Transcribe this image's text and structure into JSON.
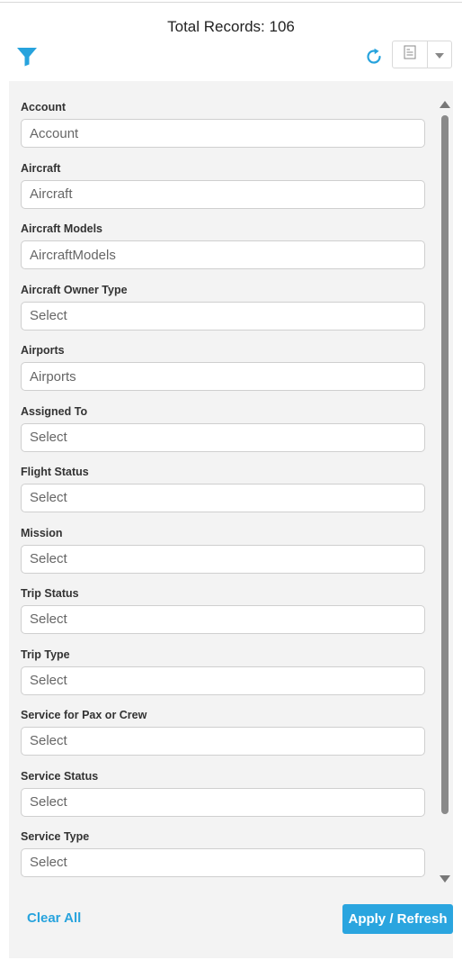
{
  "header": {
    "total_records": "Total Records: 106"
  },
  "toolbar": {
    "filter_icon": "filter-icon",
    "refresh_icon": "refresh-icon",
    "export_icon": "document-icon",
    "dropdown_icon": "caret-down-icon",
    "accent_color": "#27a3dd"
  },
  "filters": [
    {
      "label": "Account",
      "placeholder": "Account",
      "type": "input"
    },
    {
      "label": "Aircraft",
      "placeholder": "Aircraft",
      "type": "input"
    },
    {
      "label": "Aircraft Models",
      "placeholder": "AircraftModels",
      "type": "input"
    },
    {
      "label": "Aircraft Owner Type",
      "placeholder": "Select",
      "type": "select"
    },
    {
      "label": "Airports",
      "placeholder": "Airports",
      "type": "input"
    },
    {
      "label": "Assigned To",
      "placeholder": "Select",
      "type": "select"
    },
    {
      "label": "Flight Status",
      "placeholder": "Select",
      "type": "select"
    },
    {
      "label": "Mission",
      "placeholder": "Select",
      "type": "select"
    },
    {
      "label": "Trip Status",
      "placeholder": "Select",
      "type": "select"
    },
    {
      "label": "Trip Type",
      "placeholder": "Select",
      "type": "select"
    },
    {
      "label": "Service for Pax or Crew",
      "placeholder": "Select",
      "type": "select"
    },
    {
      "label": "Service Status",
      "placeholder": "Select",
      "type": "select"
    },
    {
      "label": "Service Type",
      "placeholder": "Select",
      "type": "select"
    }
  ],
  "footer": {
    "clear_all": "Clear All",
    "apply_refresh": "Apply / Refresh",
    "button_color": "#2aa5df"
  }
}
